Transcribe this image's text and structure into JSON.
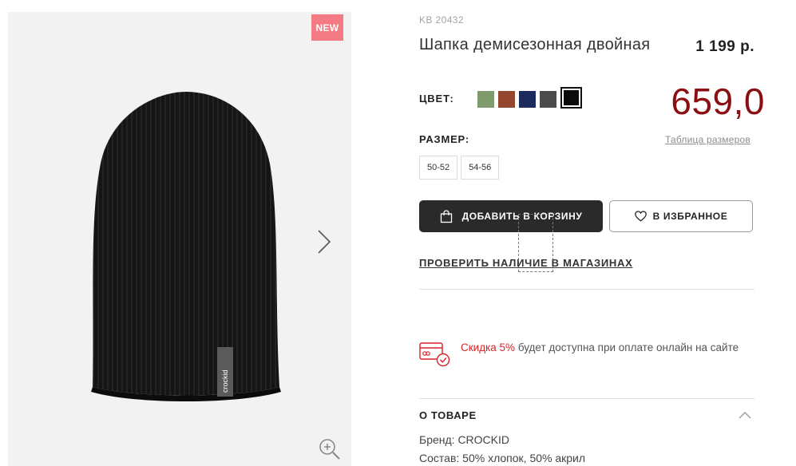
{
  "gallery": {
    "badge": "NEW",
    "logo_text": "crockid"
  },
  "product": {
    "sku": "KB 20432",
    "title": "Шапка демисезонная двойная",
    "old_price": "1 199 р.",
    "new_price": "659,0"
  },
  "color": {
    "label": "ЦВЕТ:",
    "swatches": [
      "#7f9a6c",
      "#94462e",
      "#1d2a5e",
      "#494b4d",
      "#0b0b0b"
    ],
    "selected_index": 4
  },
  "size": {
    "label": "РАЗМЕР:",
    "table_link": "Таблица размеров",
    "options": [
      "50-52",
      "54-56"
    ]
  },
  "actions": {
    "add_to_cart": "ДОБАВИТЬ В КОРЗИНУ",
    "favorite": "В ИЗБРАННОЕ",
    "check_stores": "ПРОВЕРИТЬ НАЛИЧИЕ В МАГАЗИНАХ"
  },
  "promo": {
    "highlight": "Скидка 5%",
    "text": " будет доступна при оплате онлайн на сайте"
  },
  "about": {
    "title": "О ТОВАРЕ",
    "brand": "Бренд: CROCKID",
    "composition": "Состав: 50% хлопок, 50% акрил"
  },
  "colors": {
    "accent_price": "#8b0f12",
    "promo_red": "#d8232a",
    "badge": "#f47b84",
    "cart_button": "#2a2a2a"
  }
}
